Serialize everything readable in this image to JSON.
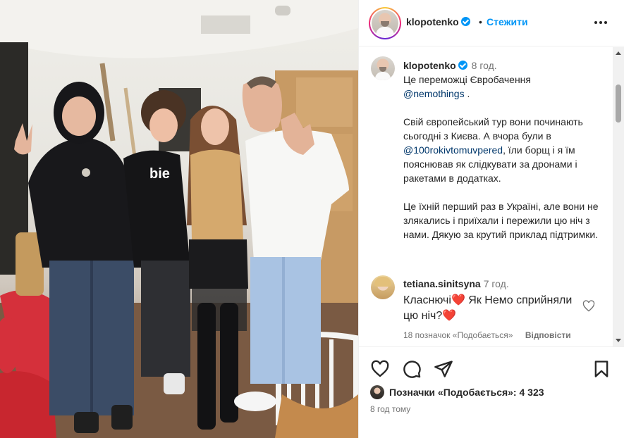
{
  "post": {
    "username": "klopotenko",
    "follow_label": "Стежити",
    "separator": "•",
    "more_label": "More options"
  },
  "caption": {
    "username": "klopotenko",
    "time": "8 год.",
    "line1": "Це переможці Євробачення",
    "mention1": "@nemothings",
    "line1_end": ".",
    "para2_a": "Свій європейський тур вони починають сьогодні з Києва. А вчора були в",
    "mention2": "@100rokivtomuvpered",
    "para2_b": ", їли борщ і я їм пояснював як слідкувати за дронами і ракетами в додатках.",
    "para3": "Це їхній перший раз в Україні, але вони не злякались і приїхали і пережили цю ніч з нами. Дякую за крутий приклад підтримки."
  },
  "comment": {
    "username": "tetiana.sinitsyna",
    "time": "7 год.",
    "text_a": "Класнючі",
    "heart": "❤️",
    "text_b": " Як Немо сприйняли цю ніч?",
    "likes": "18 позначок «Подобається»",
    "reply_label": "Відповісти"
  },
  "footer": {
    "likes_text": "Позначки «Подобається»: 4 323",
    "post_time": "8 год тому"
  },
  "icons": {
    "like": "heart-icon",
    "comment": "comment-icon",
    "share": "paper-plane-icon",
    "save": "bookmark-icon",
    "more": "ellipsis-icon",
    "verified": "verified-badge-icon"
  },
  "colors": {
    "accent": "#0095f6",
    "text": "#262626",
    "muted": "#737373",
    "link": "#00376b",
    "heart": "#e0245e"
  }
}
